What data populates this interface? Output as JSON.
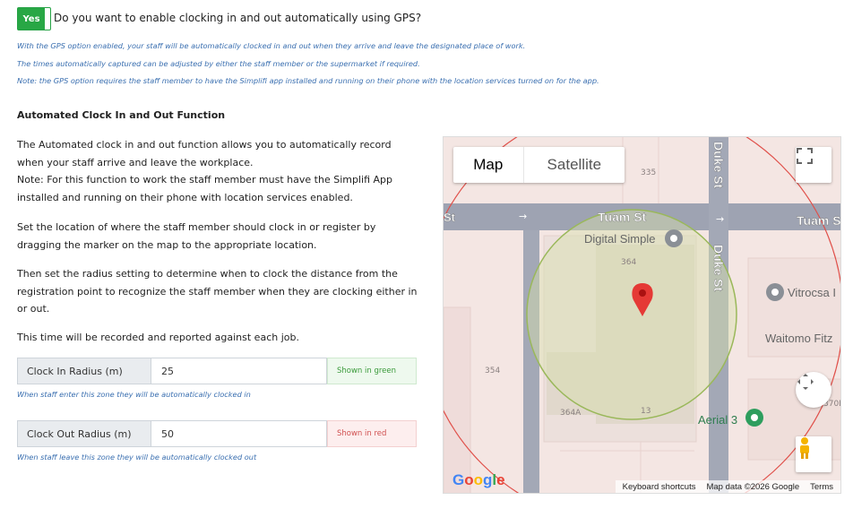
{
  "gps": {
    "toggle_label": "Yes",
    "question": "Do you want to enable clocking in and out automatically using GPS?",
    "notes": [
      "With the GPS option enabled, your staff will be automatically clocked in and out when they arrive and leave the designated place of work.",
      "The times automatically captured can be adjusted by either the staff member or the supermarket if required.",
      "Note: the GPS option requires the staff member to have the Simplifi app installed and running on their phone with the location services turned on for the app."
    ]
  },
  "section": {
    "heading": "Automated Clock In and Out Function",
    "para1": "The Automated clock in and out function allows you to automatically record when your staff arrive and leave the workplace.",
    "para1_note": "Note: For this function to work the staff member must have the Simplifi App installed and running on their phone with location services enabled.",
    "para2": "Set the location of where the staff member should clock in or register by dragging the marker on the map to the appropriate location.",
    "para3": "Then set the radius setting to determine when to clock the distance from the registration point to recognize the staff member when they are clocking either in or out.",
    "para4": "This time will be recorded and reported against each job."
  },
  "clock_in": {
    "label": "Clock In Radius (m)",
    "value": "25",
    "tag": "Shown in green",
    "hint": "When staff enter this zone they will be automatically clocked in"
  },
  "clock_out": {
    "label": "Clock Out Radius (m)",
    "value": "50",
    "tag": "Shown in red",
    "hint": "When staff leave this zone they will be automatically clocked out"
  },
  "map": {
    "type_map": "Map",
    "type_satellite": "Satellite",
    "streets": {
      "tuam_left": "St",
      "tuam": "Tuam St",
      "tuam_right": "Tuam S",
      "duke_top": "Duke St",
      "duke": "Duke St"
    },
    "places": {
      "digital_simple": "Digital Simple",
      "vitrocsa": "Vitrocsa I",
      "waitomo": "Waitomo Fitz",
      "aerial": "Aerial 3"
    },
    "numbers": {
      "n335": "335",
      "n364": "364",
      "n354": "354",
      "n364a": "364A",
      "n13": "13",
      "n370": "370E"
    },
    "google": "Google",
    "footer": {
      "shortcuts": "Keyboard shortcuts",
      "data": "Map data ©2026 Google",
      "terms": "Terms"
    },
    "colors": {
      "clock_in": "#9ab85a",
      "clock_out": "#e0504a",
      "marker": "#e53935"
    }
  }
}
